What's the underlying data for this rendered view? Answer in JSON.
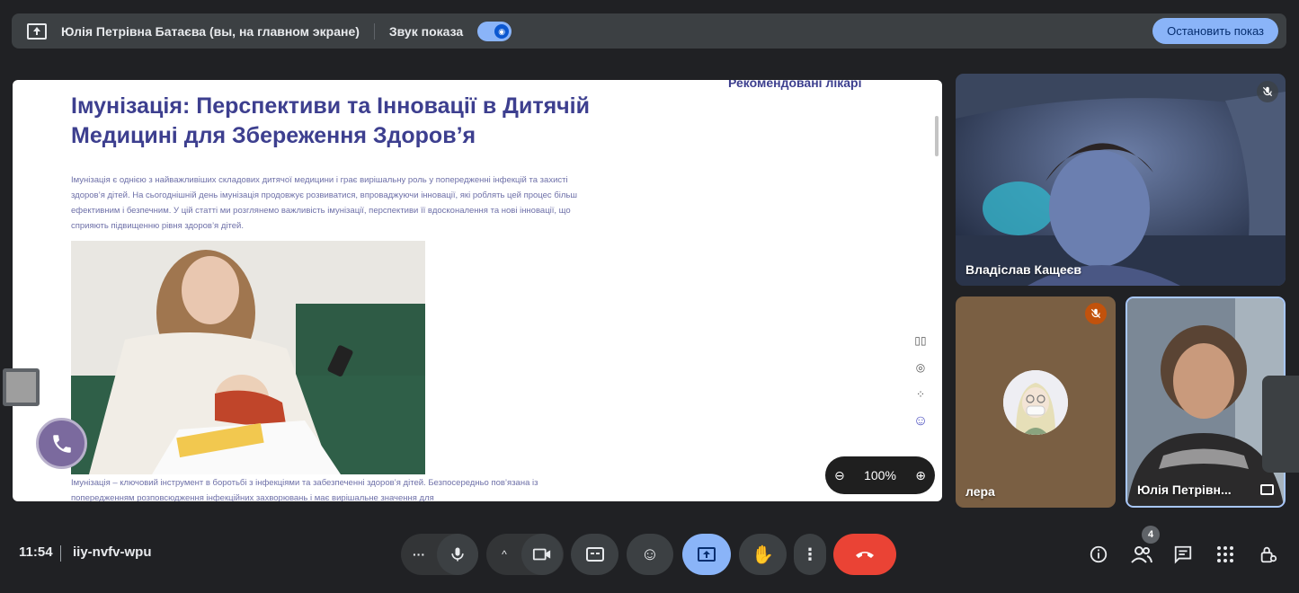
{
  "topbar": {
    "presenter_label": "Юлія Петрівна Батаєва (вы, на главном экране)",
    "sound_label": "Звук показа",
    "stop_button": "Остановить показ"
  },
  "screen": {
    "recommended_doctors": "Рекомендовані лікарі",
    "title": "Імунізація: Перспективи та Інновації в Дитячій Медицині для Збереження Здоров’я",
    "intro": "Імунізація є однією з найважливіших складових дитячої медицини і грає вирішальну роль у попередженні інфекцій та захисті здоров’я дітей. На сьогоднішній день імунізація продовжує розвиватися, впроваджуючи інновації, які роблять цей процес більш ефективним і безпечним. У цій статті ми розглянемо важливість імунізації, перспективи її вдосконалення та нові інновації, що сприяють підвищенню рівня здоров’я дітей.",
    "footer": "Імунізація – ключовий інструмент в боротьбі з інфекціями та забезпеченні здоров’я дітей. Безпосередньо пов’язана із попередженням розповсюдження інфекційних захворювань і має вирішальне значення для",
    "zoom_level": "100%"
  },
  "participants": [
    {
      "name": "Владіслав Кащеєв",
      "muted": true
    },
    {
      "name": "лера",
      "muted": true
    },
    {
      "name": "Юлія Петрівн...",
      "muted": false
    }
  ],
  "bottombar": {
    "time": "11:54",
    "meeting_code": "iiy-nvfv-wpu",
    "participant_count": "4"
  },
  "colors": {
    "accent": "#8ab4f8",
    "end_call": "#ea4335",
    "article_heading": "#3d3f8f"
  }
}
